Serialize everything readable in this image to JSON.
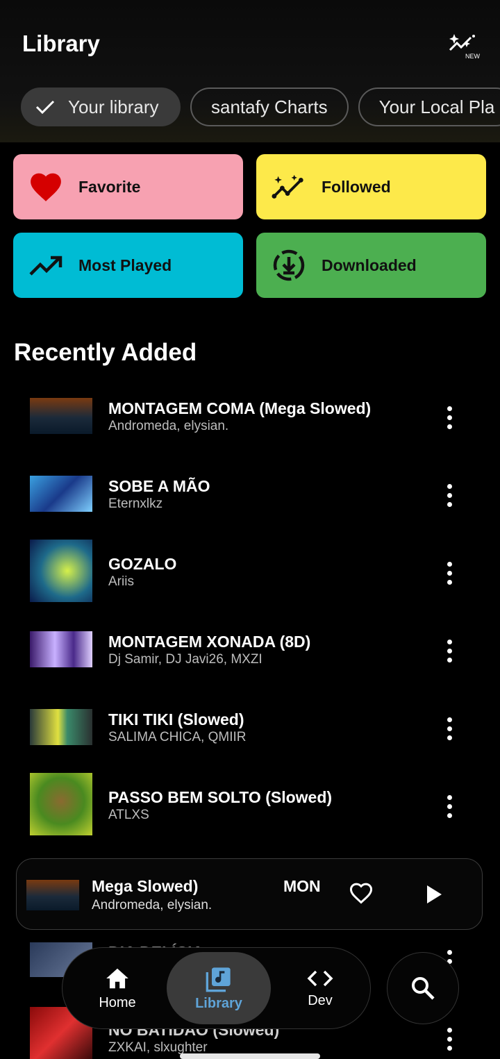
{
  "header": {
    "title": "Library",
    "new_badge": "NEW"
  },
  "chips": [
    {
      "label": "Your library",
      "selected": true
    },
    {
      "label": "santafy Charts",
      "selected": false
    },
    {
      "label": "Your Local Pla",
      "selected": false
    }
  ],
  "tiles": [
    {
      "label": "Favorite",
      "icon": "heart-icon",
      "color": "#f7a1b1"
    },
    {
      "label": "Followed",
      "icon": "sparkle-chart-icon",
      "color": "#fde94a"
    },
    {
      "label": "Most Played",
      "icon": "trending-up-icon",
      "color": "#00bcd4"
    },
    {
      "label": "Downloaded",
      "icon": "download-circle-icon",
      "color": "#4caf50"
    }
  ],
  "section_title": "Recently Added",
  "songs": [
    {
      "title": "MONTAGEM COMA (Mega Slowed)",
      "artist": "Andromeda, elysian."
    },
    {
      "title": "SOBE A MÃO",
      "artist": "Eternxlkz"
    },
    {
      "title": "GOZALO",
      "artist": "Ariis"
    },
    {
      "title": "MONTAGEM XONADA (8D)",
      "artist": "Dj Samir, DJ Javi26, MXZI"
    },
    {
      "title": "TIKI TIKI (Slowed)",
      "artist": "SALIMA CHICA, QMIIR"
    },
    {
      "title": "PASSO BEM SOLTO (Slowed)",
      "artist": "ATLXS"
    },
    {
      "title": "DIA DELÍCIA",
      "artist": ""
    },
    {
      "title": "NO BATIDÃO (Slowed)",
      "artist": "ZXKAI, slxughter"
    }
  ],
  "player": {
    "title_part1": "Mega Slowed)",
    "title_part2": "MON",
    "artist": "Andromeda, elysian."
  },
  "nav": [
    {
      "label": "Home",
      "icon": "home-icon"
    },
    {
      "label": "Library",
      "icon": "library-music-icon",
      "active": true
    },
    {
      "label": "Dev",
      "icon": "code-icon"
    }
  ]
}
